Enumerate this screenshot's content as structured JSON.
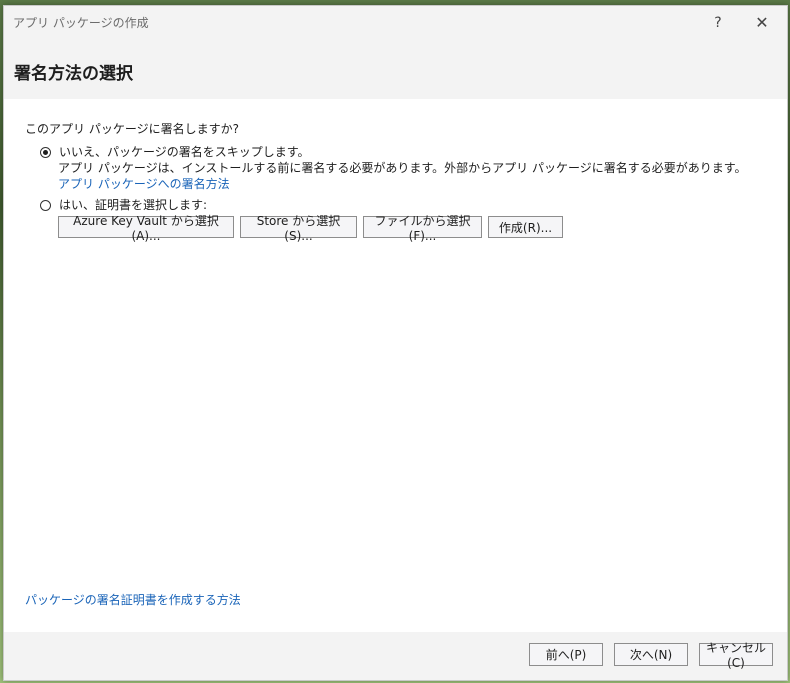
{
  "window": {
    "title": "アプリ パッケージの作成",
    "help_symbol": "?",
    "close_symbol": "✕"
  },
  "header": {
    "title": "署名方法の選択"
  },
  "main": {
    "question": "このアプリ パッケージに署名しますか?",
    "option_skip": {
      "label": "いいえ、パッケージの署名をスキップします。",
      "description": "アプリ パッケージは、インストールする前に署名する必要があります。外部からアプリ パッケージに署名する必要があります。",
      "link": "アプリ パッケージへの署名方法",
      "selected": true
    },
    "option_cert": {
      "label": "はい、証明書を選択します:",
      "selected": false,
      "buttons": {
        "azure": "Azure Key Vault から選択(A)...",
        "store": "Store から選択(S)...",
        "file": "ファイルから選択(F)...",
        "create": "作成(R)..."
      }
    },
    "bottom_link": "パッケージの署名証明書を作成する方法"
  },
  "footer": {
    "back": "前へ(P)",
    "next": "次へ(N)",
    "cancel": "キャンセル(C)"
  },
  "colors": {
    "link": "#1a64b8",
    "chrome": "#f3f3f3"
  }
}
